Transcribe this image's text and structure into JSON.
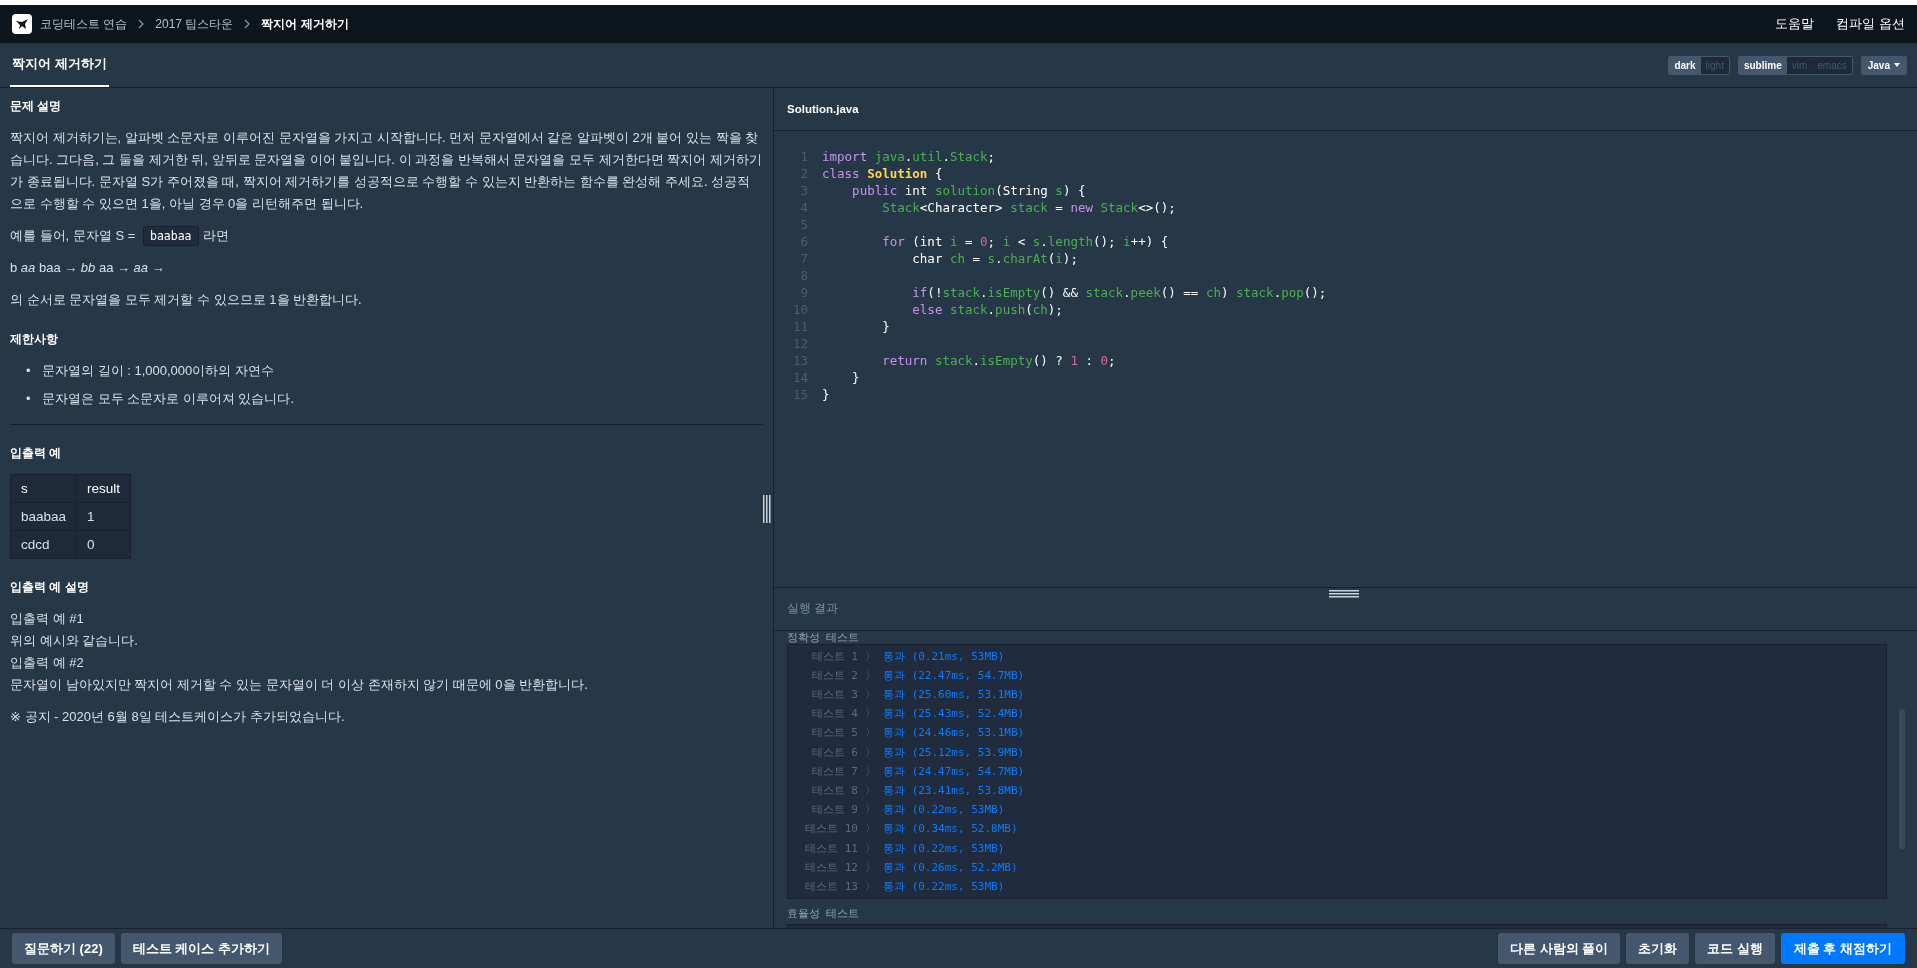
{
  "nav": {
    "breadcrumb": [
      {
        "label": "코딩테스트 연습",
        "current": false
      },
      {
        "label": "2017 팁스타운",
        "current": false
      },
      {
        "label": "짝지어 제거하기",
        "current": true
      }
    ],
    "links": [
      "도움말",
      "컴파일 옵션"
    ]
  },
  "header": {
    "tab": "짝지어 제거하기",
    "themes": [
      {
        "label": "dark",
        "selected": true
      },
      {
        "label": "light",
        "selected": false
      }
    ],
    "keymaps": [
      {
        "label": "sublime",
        "selected": true
      },
      {
        "label": "vim",
        "selected": false
      },
      {
        "label": "emacs",
        "selected": false
      }
    ],
    "language": "Java"
  },
  "problem": {
    "sections": [
      {
        "title": "문제 설명",
        "blocks": [
          {
            "kind": "para",
            "text": "짝지어 제거하기는, 알파벳 소문자로 이루어진 문자열을 가지고 시작합니다. 먼저 문자열에서 같은 알파벳이 2개 붙어 있는 짝을 찾습니다. 그다음, 그 둘을 제거한 뒤, 앞뒤로 문자열을 이어 붙입니다. 이 과정을 반복해서 문자열을 모두 제거한다면 짝지어 제거하기가 종료됩니다. 문자열 S가 주어졌을 때, 짝지어 제거하기를 성공적으로 수행할 수 있는지 반환하는 함수를 완성해 주세요. 성공적으로 수행할 수 있으면 1을, 아닐 경우 0을 리턴해주면 됩니다."
          },
          {
            "kind": "code-para",
            "before": "예를 들어, 문자열 S =",
            "code": "baabaa",
            "after": "라면"
          },
          {
            "kind": "para",
            "text": "b *aa* baa → *bb* aa → *aa* →"
          },
          {
            "kind": "para",
            "text": "의 순서로 문자열을 모두 제거할 수 있으므로 1을 반환합니다."
          }
        ]
      },
      {
        "title": "제한사항",
        "blocks": [
          {
            "kind": "list",
            "items": [
              {
                "marker": "•",
                "text": "문자열의 길이 : 1,000,000이하의 자연수"
              },
              {
                "marker": "•",
                "text": "문자열은 모두 소문자로 이루어져 있습니다."
              }
            ]
          },
          {
            "kind": "rule"
          }
        ]
      },
      {
        "title": "입출력 예",
        "blocks": [
          {
            "kind": "table",
            "columns": [
              "s",
              "result"
            ],
            "rows": [
              [
                "baabaa",
                "1"
              ],
              [
                "cdcd",
                "0"
              ]
            ]
          }
        ]
      },
      {
        "title": "입출력 예 설명",
        "blocks": [
          {
            "kind": "line",
            "text": "입출력 예 #1"
          },
          {
            "kind": "line",
            "text": "위의 예시와 같습니다."
          },
          {
            "kind": "line",
            "text": "입출력 예 #2"
          },
          {
            "kind": "line",
            "text": "문자열이 남아있지만 짝지어 제거할 수 있는 문자열이 더 이상 존재하지 않기 때문에 0을 반환합니다."
          },
          {
            "kind": "para",
            "text": "※ 공지 - 2020년 6월 8일 테스트케이스가 추가되었습니다."
          }
        ]
      }
    ]
  },
  "editor": {
    "filename": "Solution.java",
    "lines": [
      {
        "number": "1",
        "tokens": [
          {
            "text": "import ",
            "kind": "keyword"
          },
          {
            "text": "java",
            "kind": "name"
          },
          {
            "text": ".",
            "kind": "plain"
          },
          {
            "text": "util",
            "kind": "name"
          },
          {
            "text": ".",
            "kind": "plain"
          },
          {
            "text": "Stack",
            "kind": "name"
          },
          {
            "text": ";",
            "kind": "plain"
          }
        ]
      },
      {
        "number": "2",
        "tokens": [
          {
            "text": "class ",
            "kind": "keyword"
          },
          {
            "text": "Solution",
            "kind": "class"
          },
          {
            "text": " {",
            "kind": "plain"
          }
        ]
      },
      {
        "number": "3",
        "tokens": [
          {
            "text": "    public",
            "kind": "keyword"
          },
          {
            "text": " int ",
            "kind": "plain"
          },
          {
            "text": "solution",
            "kind": "name"
          },
          {
            "text": "(String ",
            "kind": "plain"
          },
          {
            "text": "s",
            "kind": "name"
          },
          {
            "text": ") {",
            "kind": "plain"
          }
        ]
      },
      {
        "number": "4",
        "tokens": [
          {
            "text": "        Stack",
            "kind": "name"
          },
          {
            "text": "<Character> ",
            "kind": "plain"
          },
          {
            "text": "stack",
            "kind": "name"
          },
          {
            "text": " = ",
            "kind": "plain"
          },
          {
            "text": "new ",
            "kind": "keyword"
          },
          {
            "text": "Stack",
            "kind": "name"
          },
          {
            "text": "<>();",
            "kind": "plain"
          }
        ]
      },
      {
        "number": "5"
      },
      {
        "number": "6",
        "tokens": [
          {
            "text": "        for",
            "kind": "keyword"
          },
          {
            "text": " (int ",
            "kind": "plain"
          },
          {
            "text": "i",
            "kind": "name"
          },
          {
            "text": " = ",
            "kind": "plain"
          },
          {
            "text": "0",
            "kind": "number"
          },
          {
            "text": "; ",
            "kind": "plain"
          },
          {
            "text": "i",
            "kind": "name"
          },
          {
            "text": " < ",
            "kind": "plain"
          },
          {
            "text": "s",
            "kind": "name"
          },
          {
            "text": ".",
            "kind": "plain"
          },
          {
            "text": "length",
            "kind": "name"
          },
          {
            "text": "(); ",
            "kind": "plain"
          },
          {
            "text": "i",
            "kind": "name"
          },
          {
            "text": "++) {",
            "kind": "plain"
          }
        ]
      },
      {
        "number": "7",
        "tokens": [
          {
            "text": "            char ",
            "kind": "plain"
          },
          {
            "text": "ch",
            "kind": "name"
          },
          {
            "text": " = ",
            "kind": "plain"
          },
          {
            "text": "s",
            "kind": "name"
          },
          {
            "text": ".",
            "kind": "plain"
          },
          {
            "text": "charAt",
            "kind": "name"
          },
          {
            "text": "(",
            "kind": "plain"
          },
          {
            "text": "i",
            "kind": "name"
          },
          {
            "text": ");",
            "kind": "plain"
          }
        ]
      },
      {
        "number": "8"
      },
      {
        "number": "9",
        "tokens": [
          {
            "text": "            if",
            "kind": "keyword"
          },
          {
            "text": "(!",
            "kind": "plain"
          },
          {
            "text": "stack",
            "kind": "name"
          },
          {
            "text": ".",
            "kind": "plain"
          },
          {
            "text": "isEmpty",
            "kind": "name"
          },
          {
            "text": "() && ",
            "kind": "plain"
          },
          {
            "text": "stack",
            "kind": "name"
          },
          {
            "text": ".",
            "kind": "plain"
          },
          {
            "text": "peek",
            "kind": "name"
          },
          {
            "text": "() == ",
            "kind": "plain"
          },
          {
            "text": "ch",
            "kind": "name"
          },
          {
            "text": ") ",
            "kind": "plain"
          },
          {
            "text": "stack",
            "kind": "name"
          },
          {
            "text": ".",
            "kind": "plain"
          },
          {
            "text": "pop",
            "kind": "name"
          },
          {
            "text": "();",
            "kind": "plain"
          }
        ]
      },
      {
        "number": "10",
        "tokens": [
          {
            "text": "            else ",
            "kind": "keyword"
          },
          {
            "text": "stack",
            "kind": "name"
          },
          {
            "text": ".",
            "kind": "plain"
          },
          {
            "text": "push",
            "kind": "name"
          },
          {
            "text": "(",
            "kind": "plain"
          },
          {
            "text": "ch",
            "kind": "name"
          },
          {
            "text": ");",
            "kind": "plain"
          }
        ]
      },
      {
        "number": "11",
        "tokens": [
          {
            "text": "        }",
            "kind": "plain"
          }
        ]
      },
      {
        "number": "12"
      },
      {
        "number": "13",
        "tokens": [
          {
            "text": "        return ",
            "kind": "keyword"
          },
          {
            "text": "stack",
            "kind": "name"
          },
          {
            "text": ".",
            "kind": "plain"
          },
          {
            "text": "isEmpty",
            "kind": "name"
          },
          {
            "text": "() ? ",
            "kind": "plain"
          },
          {
            "text": "1",
            "kind": "number"
          },
          {
            "text": " : ",
            "kind": "plain"
          },
          {
            "text": "0",
            "kind": "number"
          },
          {
            "text": ";",
            "kind": "plain"
          }
        ]
      },
      {
        "number": "14",
        "tokens": [
          {
            "text": "    }",
            "kind": "plain"
          }
        ]
      },
      {
        "number": "15",
        "tokens": [
          {
            "text": "}",
            "kind": "plain"
          }
        ]
      }
    ]
  },
  "results": {
    "title": "실행 결과",
    "groups": [
      {
        "label": "정확성  테스트",
        "tests": [
          {
            "name": "테스트 1",
            "sep": "〉",
            "status": "통과",
            "detail": "(0.21ms, 53MB)"
          },
          {
            "name": "테스트 2",
            "sep": "〉",
            "status": "통과",
            "detail": "(22.47ms, 54.7MB)"
          },
          {
            "name": "테스트 3",
            "sep": "〉",
            "status": "통과",
            "detail": "(25.60ms, 53.1MB)"
          },
          {
            "name": "테스트 4",
            "sep": "〉",
            "status": "통과",
            "detail": "(25.43ms, 52.4MB)"
          },
          {
            "name": "테스트 5",
            "sep": "〉",
            "status": "통과",
            "detail": "(24.46ms, 53.1MB)"
          },
          {
            "name": "테스트 6",
            "sep": "〉",
            "status": "통과",
            "detail": "(25.12ms, 53.9MB)"
          },
          {
            "name": "테스트 7",
            "sep": "〉",
            "status": "통과",
            "detail": "(24.47ms, 54.7MB)"
          },
          {
            "name": "테스트 8",
            "sep": "〉",
            "status": "통과",
            "detail": "(23.41ms, 53.8MB)"
          },
          {
            "name": "테스트 9",
            "sep": "〉",
            "status": "통과",
            "detail": "(0.22ms, 53MB)"
          },
          {
            "name": "테스트 10",
            "sep": "〉",
            "status": "통과",
            "detail": "(0.34ms, 52.8MB)"
          },
          {
            "name": "테스트 11",
            "sep": "〉",
            "status": "통과",
            "detail": "(0.22ms, 53MB)"
          },
          {
            "name": "테스트 12",
            "sep": "〉",
            "status": "통과",
            "detail": "(0.26ms, 52.2MB)"
          },
          {
            "name": "테스트 13",
            "sep": "〉",
            "status": "통과",
            "detail": "(0.22ms, 53MB)"
          }
        ]
      },
      {
        "label": "효율성  테스트"
      }
    ]
  },
  "footer": {
    "left": [
      "질문하기 (22)",
      "테스트 케이스 추가하기"
    ],
    "right": [
      {
        "label": "다른 사람의 풀이",
        "kind": "secondary"
      },
      {
        "label": "초기화",
        "kind": "secondary"
      },
      {
        "label": "코드 실행",
        "kind": "secondary"
      },
      {
        "label": "제출 후 채점하기",
        "kind": "primary"
      }
    ]
  }
}
